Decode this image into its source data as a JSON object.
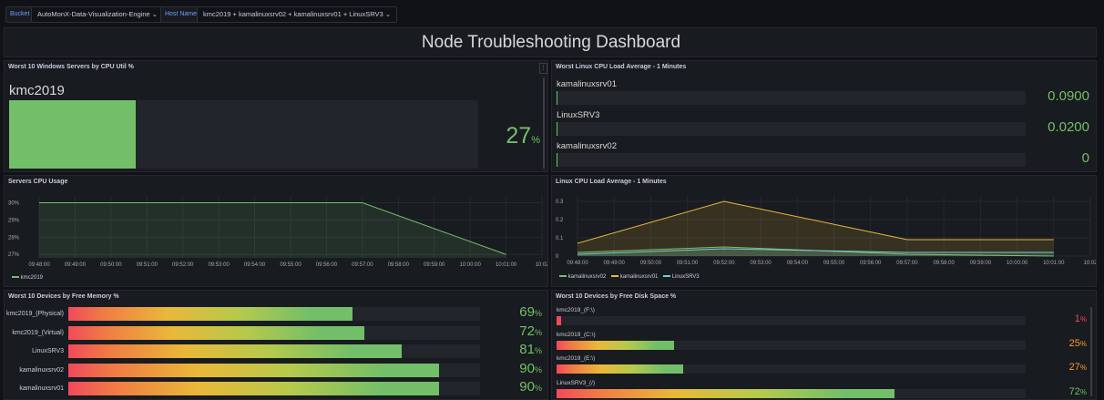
{
  "variables": {
    "bucket_label": "Bucket",
    "bucket_value": "AutoMonX-Data-Visualization-Engine",
    "host_label": "Host Name",
    "host_value": "kmc2019 + kamalinuxsrv02 + kamalinuxsrv01 + LinuxSRV3"
  },
  "dashboard": {
    "title": "Node Troubleshooting Dashboard"
  },
  "windows_cpu": {
    "title": "Worst 10 Windows Servers by CPU Util %",
    "host": "kmc2019",
    "value_text": "27",
    "unit": "%",
    "fill_fraction": 0.27
  },
  "linux_load": {
    "title": "Worst Linux CPU Load Average - 1 Minutes",
    "items": [
      {
        "name": "kamalinuxsrv01",
        "value": "0.0900"
      },
      {
        "name": "LinuxSRV3",
        "value": "0.0200"
      },
      {
        "name": "kamalinuxsrv02",
        "value": "0"
      }
    ]
  },
  "servers_cpu": {
    "title": "Servers CPU Usage",
    "legend": "kmc2019",
    "color": "#73bf69"
  },
  "linux_cpu": {
    "title": "Linux CPU Load Average - 1 Minutes",
    "legend": [
      "kamalinuxsrv02",
      "kamalinuxsrv01",
      "LinuxSRV3"
    ],
    "colors": [
      "#73bf69",
      "#eab839",
      "#6ed0e0"
    ]
  },
  "free_memory": {
    "title": "Worst 10 Devices by Free Memory %",
    "items": [
      {
        "name": "kmc2019_(Physical)",
        "value": 69,
        "text": "69"
      },
      {
        "name": "kmc2019_(Virtual)",
        "value": 72,
        "text": "72"
      },
      {
        "name": "LinuxSRV3",
        "value": 81,
        "text": "81"
      },
      {
        "name": "kamalinuxsrv02",
        "value": 90,
        "text": "90"
      },
      {
        "name": "kamalinuxsrv01",
        "value": 90,
        "text": "90"
      }
    ],
    "unit": "%"
  },
  "free_disk": {
    "title": "Worst 10 Devices by Free Disk Space %",
    "items": [
      {
        "name": "kmc2019_(F:\\)",
        "value": 1,
        "text": "1",
        "color": "#f2495c"
      },
      {
        "name": "kmc2019_(C:\\)",
        "value": 25,
        "text": "25",
        "color": "#ff9830"
      },
      {
        "name": "kmc2019_(E:\\)",
        "value": 27,
        "text": "27",
        "color": "#ff9830"
      },
      {
        "name": "LinuxSRV3_(/)",
        "value": 72,
        "text": "72",
        "color": "#73bf69"
      }
    ],
    "unit": "%"
  },
  "chart_data": [
    {
      "type": "area",
      "title": "Servers CPU Usage",
      "x": [
        "09:48:00",
        "09:49:00",
        "09:50:00",
        "09:51:00",
        "09:52:00",
        "09:53:00",
        "09:54:00",
        "09:55:00",
        "09:56:00",
        "09:57:00",
        "09:58:00",
        "09:59:00",
        "10:00:00",
        "10:01:00",
        "10:02"
      ],
      "yticks": [
        "30%",
        "29%",
        "28%",
        "27%"
      ],
      "ylim": [
        26.8,
        30.4
      ],
      "series": [
        {
          "name": "kmc2019",
          "points": [
            [
              "09:48:00",
              30
            ],
            [
              "09:57:00",
              30
            ],
            [
              "10:01:00",
              27
            ]
          ]
        }
      ],
      "legend": "bottom-left"
    },
    {
      "type": "area",
      "title": "Linux CPU Load Average - 1 Minutes",
      "x": [
        "09:48:00",
        "09:49:00",
        "09:50:00",
        "09:51:00",
        "09:52:00",
        "09:53:00",
        "09:54:00",
        "09:55:00",
        "09:56:00",
        "09:57:00",
        "09:58:00",
        "09:59:00",
        "10:00:00",
        "10:01:00",
        "10:02"
      ],
      "yticks": [
        "0.3",
        "0.2",
        "0.1",
        "0"
      ],
      "ylim": [
        0,
        0.33
      ],
      "series": [
        {
          "name": "kamalinuxsrv02",
          "points": [
            [
              "09:48:00",
              0.02
            ],
            [
              "09:52:00",
              0.05
            ],
            [
              "09:57:00",
              0.01
            ],
            [
              "10:01:00",
              0
            ]
          ]
        },
        {
          "name": "kamalinuxsrv01",
          "points": [
            [
              "09:48:00",
              0.07
            ],
            [
              "09:52:00",
              0.3
            ],
            [
              "09:57:00",
              0.09
            ],
            [
              "10:01:00",
              0.09
            ]
          ]
        },
        {
          "name": "LinuxSRV3",
          "points": [
            [
              "09:48:00",
              0.01
            ],
            [
              "09:52:00",
              0.04
            ],
            [
              "09:57:00",
              0.02
            ],
            [
              "10:01:00",
              0.02
            ]
          ]
        }
      ],
      "legend": "bottom-left"
    }
  ]
}
